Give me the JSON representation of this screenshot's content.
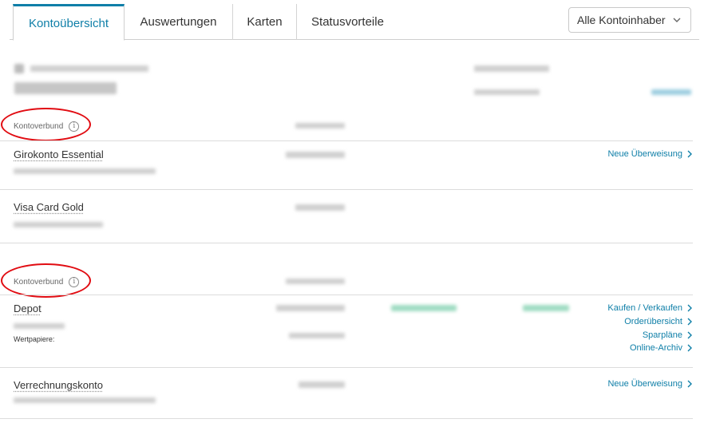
{
  "tabs": [
    {
      "label": "Kontoübersicht",
      "active": true
    },
    {
      "label": "Auswertungen",
      "active": false
    },
    {
      "label": "Karten",
      "active": false
    },
    {
      "label": "Statusvorteile",
      "active": false
    }
  ],
  "owner_select": {
    "value": "Alle Kontoinhaber"
  },
  "groups": [
    {
      "label": "Kontoverbund",
      "accounts": [
        {
          "name": "Girokonto Essential",
          "actions": [
            "Neue Überweisung"
          ]
        },
        {
          "name": "Visa Card Gold",
          "actions": []
        }
      ]
    },
    {
      "label": "Kontoverbund",
      "accounts": [
        {
          "name": "Depot",
          "sub_label": "Wertpapiere:",
          "actions": [
            "Kaufen / Verkaufen",
            "Orderübersicht",
            "Sparpläne",
            "Online-Archiv"
          ]
        },
        {
          "name": "Verrechnungskonto",
          "actions": [
            "Neue Überweisung"
          ]
        }
      ]
    }
  ],
  "colors": {
    "accent": "#0f7fa8",
    "highlight": "#e10c12",
    "positive": "#3bb98a"
  },
  "icons": {
    "info": "info-icon",
    "chevron": "chevron-right-icon",
    "select": "chevron-down-icon"
  }
}
